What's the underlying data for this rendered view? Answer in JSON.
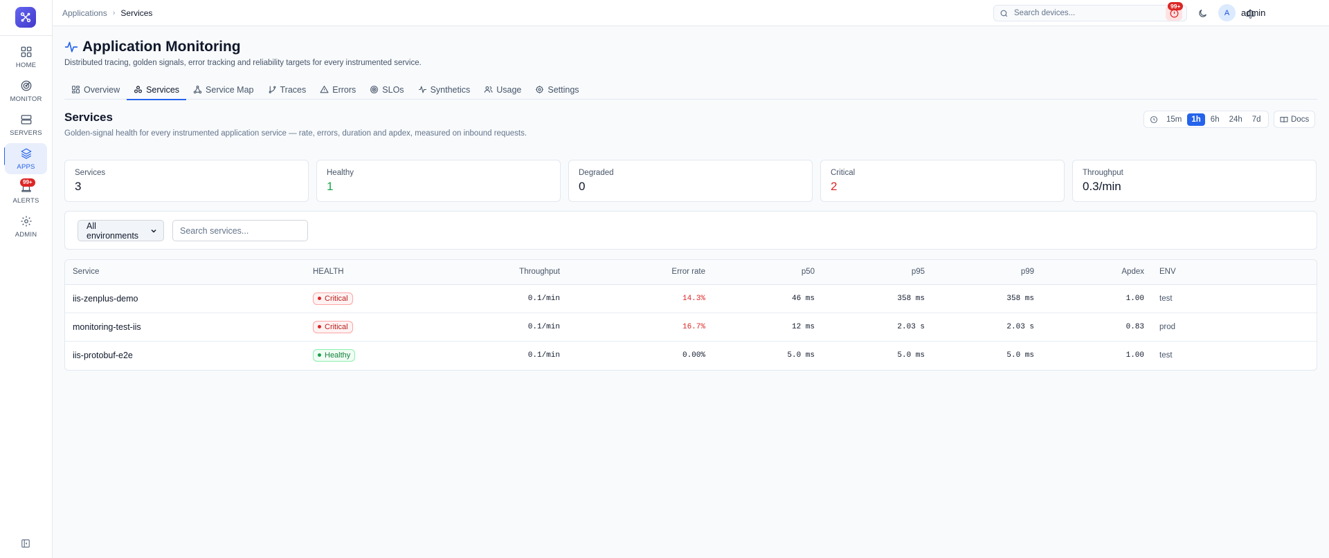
{
  "colors": {
    "accent": "#2563eb",
    "healthy": "#16a34a",
    "critical": "#dc2626"
  },
  "sidebar": {
    "items": [
      {
        "label": "HOME",
        "icon": "grid-icon"
      },
      {
        "label": "MONITOR",
        "icon": "radar-icon"
      },
      {
        "label": "SERVERS",
        "icon": "server-icon"
      },
      {
        "label": "APPS",
        "icon": "layers-icon",
        "active": true
      },
      {
        "label": "ALERTS",
        "icon": "alarm-icon",
        "badge": "99+"
      },
      {
        "label": "ADMIN",
        "icon": "gear-icon"
      }
    ]
  },
  "topbar": {
    "breadcrumb": [
      "Applications",
      "Services"
    ],
    "device_search_placeholder": "Search devices...",
    "alert_badge": "99+",
    "avatar_initial": "A",
    "username": "admin"
  },
  "header": {
    "title": "Application Monitoring",
    "subtitle": "Distributed tracing, golden signals, error tracking and reliability targets for every instrumented service."
  },
  "tabs": [
    {
      "label": "Overview",
      "icon": "dashboard-icon"
    },
    {
      "label": "Services",
      "icon": "services-icon",
      "active": true
    },
    {
      "label": "Service Map",
      "icon": "service-map-icon"
    },
    {
      "label": "Traces",
      "icon": "git-branch-icon"
    },
    {
      "label": "Errors",
      "icon": "warning-icon"
    },
    {
      "label": "SLOs",
      "icon": "target-icon"
    },
    {
      "label": "Synthetics",
      "icon": "activity-icon"
    },
    {
      "label": "Usage",
      "icon": "users-icon"
    },
    {
      "label": "Settings",
      "icon": "gear-icon"
    }
  ],
  "section": {
    "title": "Services",
    "description": "Golden-signal health for every instrumented application service — rate, errors, duration and apdex, measured on inbound requests."
  },
  "time_ranges": [
    "15m",
    "1h",
    "6h",
    "24h",
    "7d"
  ],
  "selected_range": "1h",
  "docs_label": "Docs",
  "stats": [
    {
      "label": "Services",
      "value": "3",
      "color": "#0f172a"
    },
    {
      "label": "Healthy",
      "value": "1",
      "color": "#16a34a"
    },
    {
      "label": "Degraded",
      "value": "0",
      "color": "#0f172a"
    },
    {
      "label": "Critical",
      "value": "2",
      "color": "#dc2626"
    },
    {
      "label": "Throughput",
      "value": "0.3/min",
      "color": "#0f172a"
    }
  ],
  "filters": {
    "environment_selected": "All environments",
    "search_placeholder": "Search services..."
  },
  "table": {
    "columns": [
      "Service",
      "HEALTH",
      "Throughput",
      "Error rate",
      "p50",
      "p95",
      "p99",
      "Apdex",
      "ENV"
    ],
    "rows": [
      {
        "service": "iis-zenplus-demo",
        "health": "Critical",
        "throughput": "0.1/min",
        "error_rate": "14.3%",
        "p50": "46 ms",
        "p95": "358 ms",
        "p99": "358 ms",
        "apdex": "1.00",
        "env": "test"
      },
      {
        "service": "monitoring-test-iis",
        "health": "Critical",
        "throughput": "0.1/min",
        "error_rate": "16.7%",
        "p50": "12 ms",
        "p95": "2.03 s",
        "p99": "2.03 s",
        "apdex": "0.83",
        "env": "prod"
      },
      {
        "service": "iis-protobuf-e2e",
        "health": "Healthy",
        "throughput": "0.1/min",
        "error_rate": "0.00%",
        "p50": "5.0 ms",
        "p95": "5.0 ms",
        "p99": "5.0 ms",
        "apdex": "1.00",
        "env": "test"
      }
    ]
  }
}
